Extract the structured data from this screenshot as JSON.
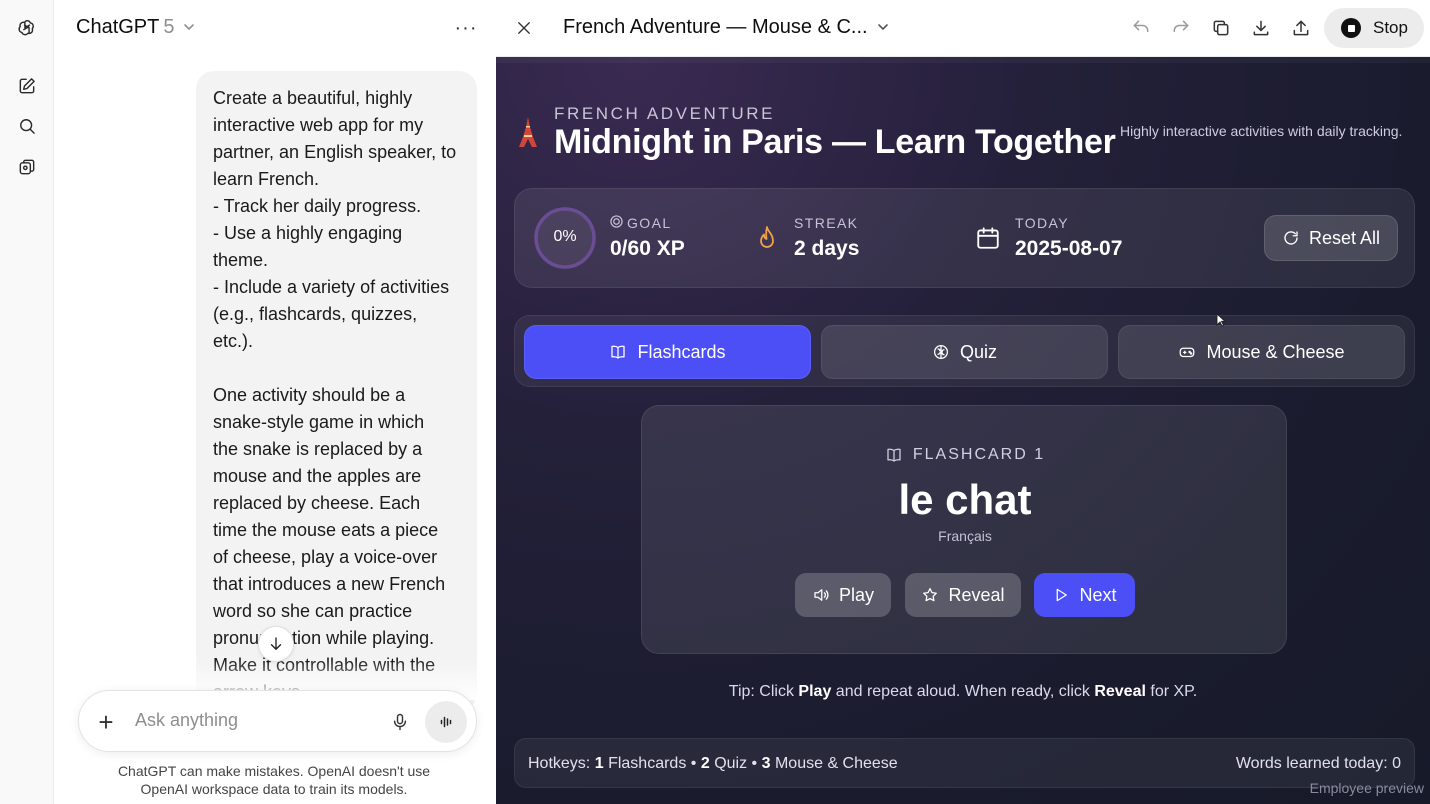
{
  "chat": {
    "model_name": "ChatGPT",
    "model_version": "5",
    "more": "···",
    "message_lines": [
      "Create a beautiful, highly",
      "interactive web app for my",
      "partner, an English speaker, to",
      "learn French.",
      "- Track her daily progress.",
      "- Use a highly engaging",
      "theme.",
      "- Include a variety of activities",
      "(e.g., flashcards, quizzes,",
      "etc.).",
      "",
      "One activity should be a",
      "snake-style game in which",
      "the snake is replaced by a",
      "mouse and the apples are",
      "replaced by cheese. Each",
      "time the mouse eats a piece",
      "of cheese, play a voice-over",
      "that introduces a new French",
      "word so she can practice",
      "pronunciation while playing.",
      "Make it controllable with the",
      "arrow keys"
    ],
    "composer_placeholder": "Ask anything",
    "composer_plus": "+",
    "disclaimer": "ChatGPT can make mistakes. OpenAI doesn't use OpenAI workspace data to train its models."
  },
  "canvas": {
    "title": "French Adventure — Mouse & C...",
    "stop_label": "Stop"
  },
  "app": {
    "kicker": "FRENCH ADVENTURE",
    "title": "Midnight in Paris — Learn Together",
    "tagline": "Highly interactive activities with daily tracking.",
    "progress_fraction": 0,
    "progress_text": "0%",
    "goal_label": "GOAL",
    "goal_value": "0/60 XP",
    "streak_label": "STREAK",
    "streak_value": "2 days",
    "today_label": "TODAY",
    "today_value": "2025-08-07",
    "reset_label": "Reset All",
    "tabs": [
      {
        "label": "Flashcards",
        "icon": "book-icon",
        "active": true
      },
      {
        "label": "Quiz",
        "icon": "brain-icon",
        "active": false
      },
      {
        "label": "Mouse & Cheese",
        "icon": "gamepad-icon",
        "active": false
      }
    ],
    "card": {
      "kicker": "FLASHCARD 1",
      "word": "le chat",
      "language": "Français",
      "play_label": "Play",
      "reveal_label": "Reveal",
      "next_label": "Next"
    },
    "tip": {
      "prefix": "Tip: Click",
      "play_word": "Play",
      "middle": "and repeat aloud. When ready, click",
      "reveal_word": "Reveal",
      "suffix": "for XP."
    },
    "hotkeys": {
      "prefix": "Hotkeys:",
      "k1": "1",
      "l1": "Flashcards",
      "k2": "2",
      "l2": "Quiz",
      "k3": "3",
      "l3": "Mouse & Cheese",
      "sep": "•"
    },
    "words_today": "Words learned today: 0",
    "employee_preview": "Employee preview"
  },
  "colors": {
    "accent": "#4c4ff5",
    "app_bg": "#1a1c2e",
    "streak_flame": "#f0a24a",
    "eiffel_red": "#d2453a"
  }
}
